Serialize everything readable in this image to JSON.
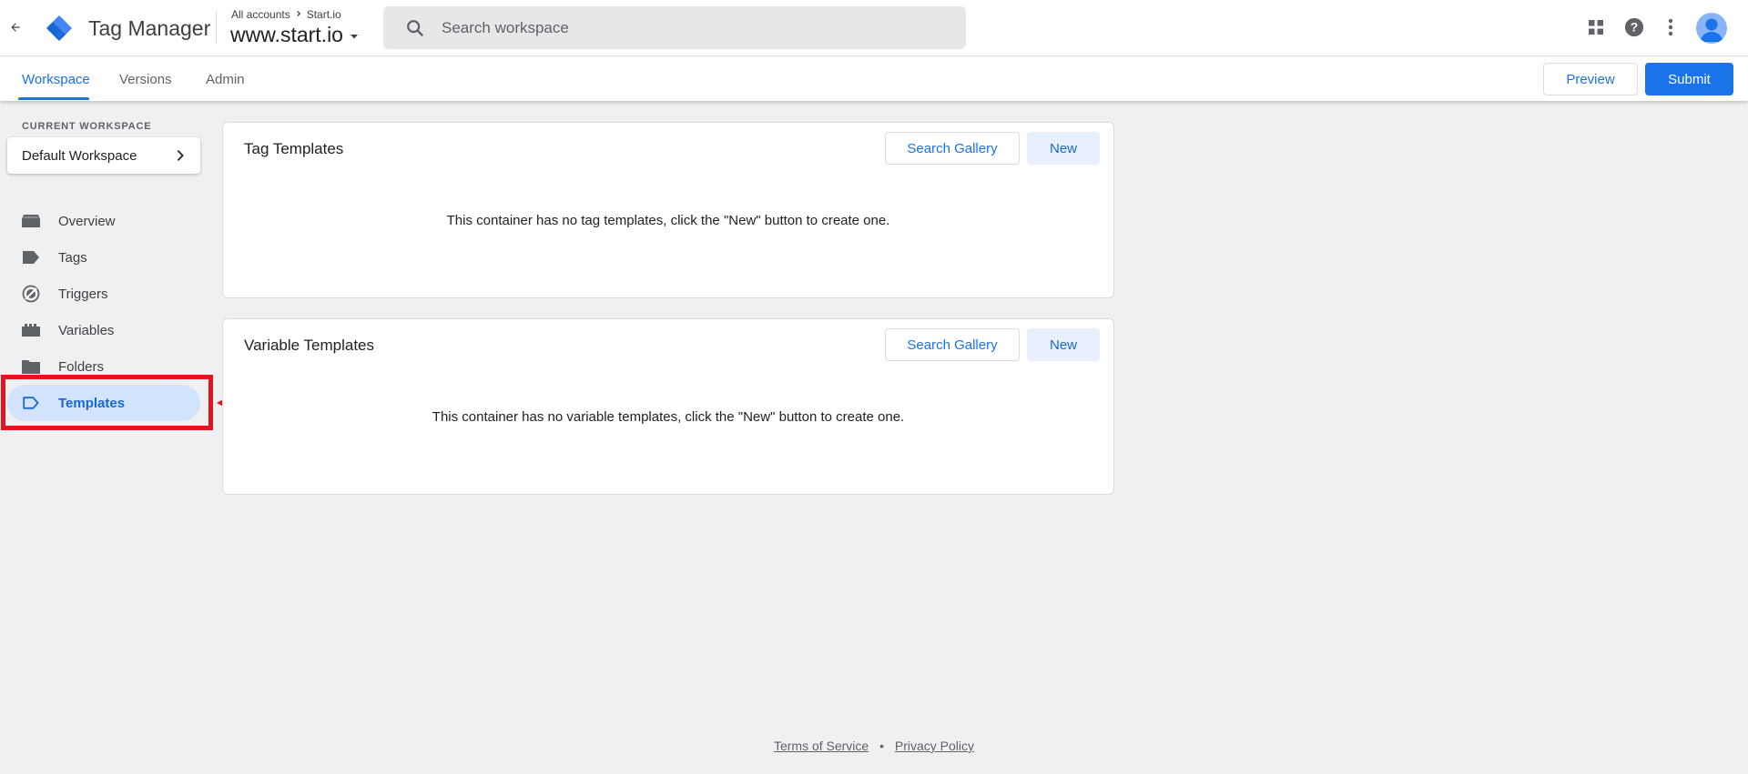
{
  "header": {
    "app_title": "Tag Manager",
    "breadcrumb": {
      "root": "All accounts",
      "account": "Start.io"
    },
    "container_name": "www.start.io",
    "search_placeholder": "Search workspace",
    "icons": [
      "apps-grid-icon",
      "help-icon",
      "more-vert-icon",
      "account-avatar"
    ]
  },
  "nav": {
    "tabs": [
      {
        "label": "Workspace",
        "active": true
      },
      {
        "label": "Versions",
        "active": false
      },
      {
        "label": "Admin",
        "active": false
      }
    ],
    "preview_label": "Preview",
    "submit_label": "Submit"
  },
  "sidebar": {
    "workspace_heading": "CURRENT WORKSPACE",
    "workspace_name": "Default Workspace",
    "items": [
      {
        "label": "Overview",
        "icon": "overview-icon"
      },
      {
        "label": "Tags",
        "icon": "tag-icon"
      },
      {
        "label": "Triggers",
        "icon": "trigger-icon"
      },
      {
        "label": "Variables",
        "icon": "variables-icon"
      },
      {
        "label": "Folders",
        "icon": "folder-icon"
      },
      {
        "label": "Templates",
        "icon": "template-icon",
        "active": true
      }
    ]
  },
  "cards": {
    "tag_templates": {
      "title": "Tag Templates",
      "gallery_label": "Search Gallery",
      "new_label": "New",
      "empty_message": "This container has no tag templates, click the \"New\" button to create one."
    },
    "variable_templates": {
      "title": "Variable Templates",
      "gallery_label": "Search Gallery",
      "new_label": "New",
      "empty_message": "This container has no variable templates, click the \"New\" button to create one."
    }
  },
  "footer": {
    "terms": "Terms of Service",
    "separator": "•",
    "privacy": "Privacy Policy"
  },
  "colors": {
    "accent": "#1a73e8",
    "annotation": "#e3141e",
    "active_bg": "#d2e3fc"
  }
}
